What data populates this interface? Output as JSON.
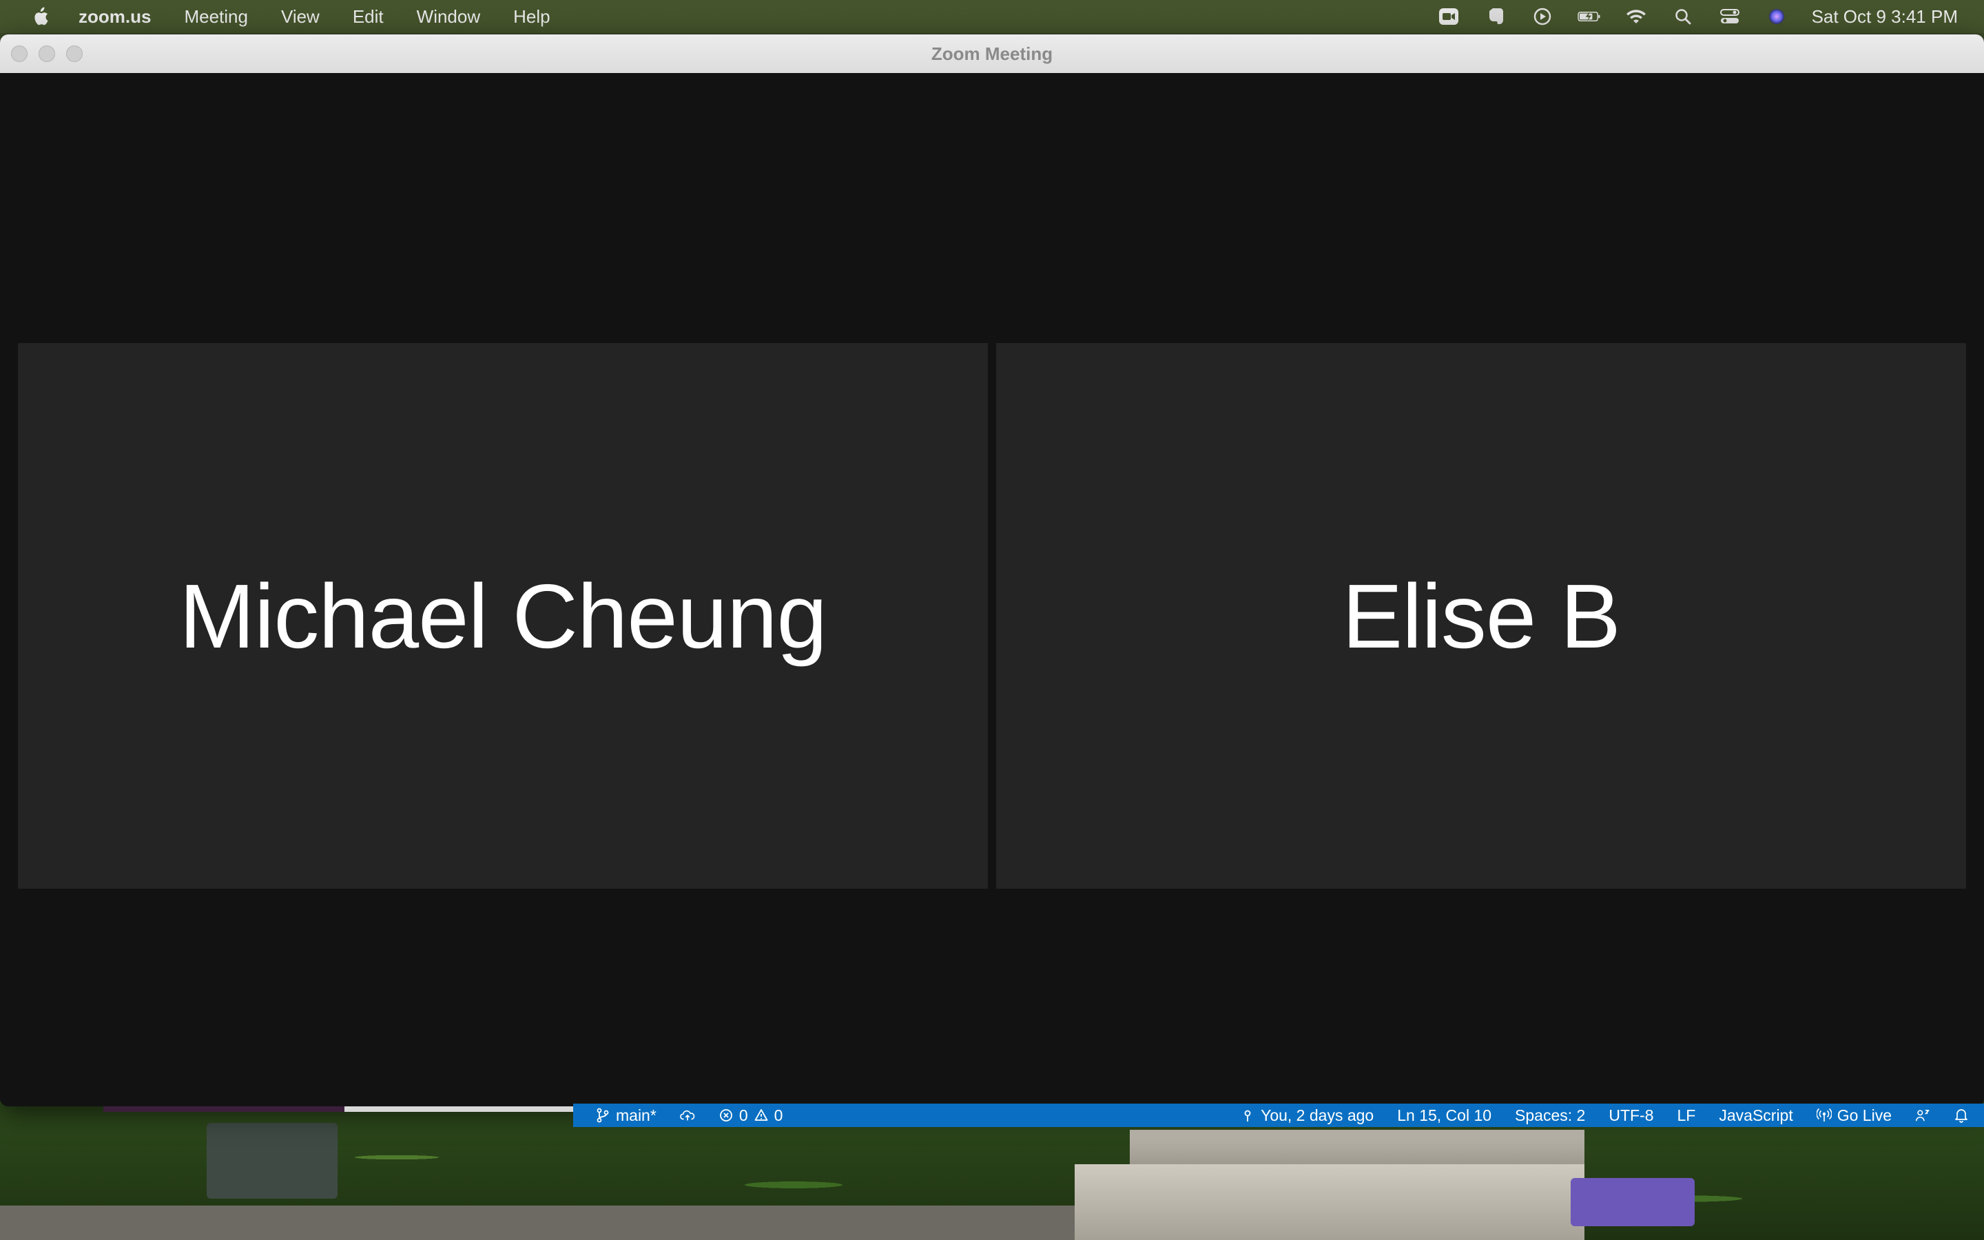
{
  "menubar": {
    "app_name": "zoom.us",
    "menus": [
      "Meeting",
      "View",
      "Edit",
      "Window",
      "Help"
    ],
    "clock": "Sat Oct 9  3:41 PM",
    "tray_icons": [
      "zoom-tray-icon",
      "evernote-icon",
      "play-icon",
      "battery-icon",
      "wifi-icon",
      "spotlight-search-icon",
      "control-center-icon",
      "siri-icon"
    ]
  },
  "window": {
    "title": "Zoom Meeting"
  },
  "participants": [
    {
      "name": "Michael Cheung"
    },
    {
      "name": "Elise B"
    }
  ],
  "vscode_status": {
    "branch": "main*",
    "errors": "0",
    "warnings": "0",
    "blame": "You, 2 days ago",
    "cursor": "Ln 15, Col 10",
    "spaces": "Spaces: 2",
    "encoding": "UTF-8",
    "eol": "LF",
    "language": "JavaScript",
    "go_live": "Go Live"
  },
  "colors": {
    "zoom_background": "#121212",
    "tile_background": "#242424",
    "vscode_status_bar": "#0a6fc2"
  }
}
